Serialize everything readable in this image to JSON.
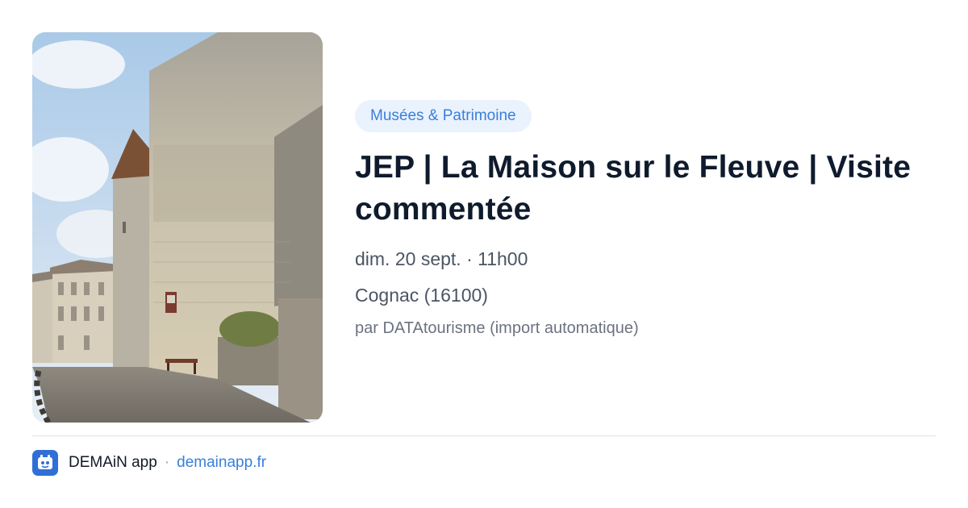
{
  "photo": {
    "subject": "stone château wall with round tower and cobbled road"
  },
  "event": {
    "category": "Musées & Patrimoine",
    "title": "JEP | La Maison sur le Fleuve | Visite commentée",
    "date": "dim. 20 sept. · 11h00",
    "location": "Cognac (16100)",
    "author": "par DATAtourisme (import automatique)"
  },
  "footer": {
    "app_name": "DEMAiN app",
    "separator": "·",
    "site": "demainapp.fr"
  },
  "colors": {
    "accent": "#3a7fd8",
    "badge_bg": "#eaf2fd",
    "title": "#0f1b2d",
    "muted": "#4b5563"
  }
}
